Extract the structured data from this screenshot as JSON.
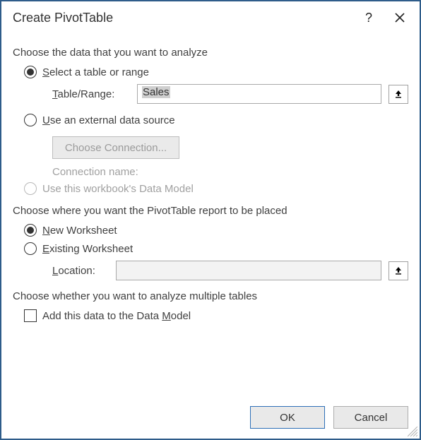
{
  "title": "Create PivotTable",
  "sectionData": "Choose the data that you want to analyze",
  "optSelectRange": {
    "pre": "",
    "u": "S",
    "post": "elect a table or range",
    "selected": true
  },
  "tableRangeLabel": {
    "u": "T",
    "post": "able/Range:"
  },
  "tableRangeValue": "Sales",
  "optExternal": {
    "u": "U",
    "post": "se an external data source",
    "selected": false
  },
  "chooseConnection": "Choose Connection...",
  "connectionName": "Connection name:",
  "optDataModel": {
    "label": "Use this workbook's Data Model",
    "disabled": true
  },
  "sectionPlace": "Choose where you want the PivotTable report to be placed",
  "optNewWS": {
    "u": "N",
    "post": "ew Worksheet",
    "selected": true
  },
  "optExistingWS": {
    "u": "E",
    "post": "xisting Worksheet",
    "selected": false
  },
  "locationLabel": {
    "u": "L",
    "post": "ocation:"
  },
  "locationValue": "",
  "sectionMulti": "Choose whether you want to analyze multiple tables",
  "chkDataModel": {
    "pre": "Add this data to the Data ",
    "u": "M",
    "post": "odel",
    "checked": false
  },
  "ok": "OK",
  "cancel": "Cancel"
}
